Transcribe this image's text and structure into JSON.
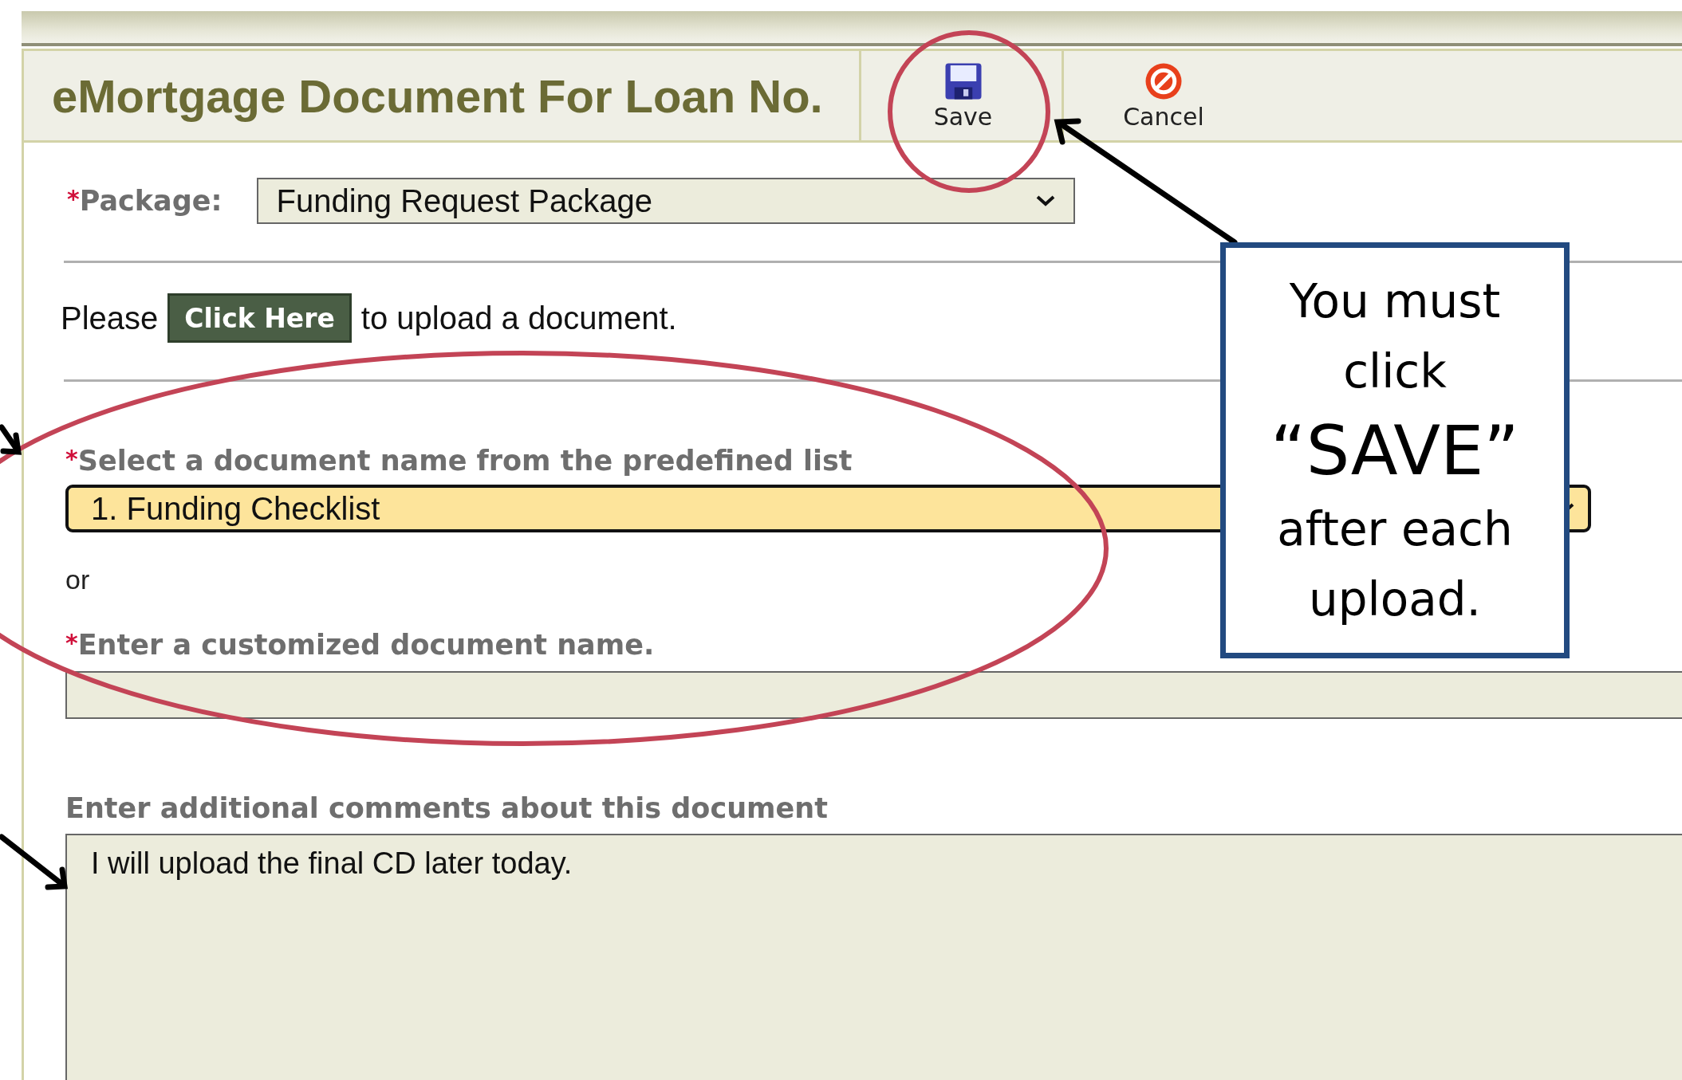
{
  "header": {
    "title": "eMortgage Document For Loan No.",
    "actions": [
      {
        "kind": "save",
        "label": "Save"
      },
      {
        "kind": "cancel",
        "label": "Cancel"
      }
    ]
  },
  "package": {
    "marker": "*",
    "label": "Package:",
    "value": "Funding Request Package"
  },
  "upload": {
    "before": "Please",
    "button": "Click Here",
    "after": "to upload a document."
  },
  "document_select": {
    "marker": "*",
    "label": "Select a document name from the predefined list",
    "value": "1. Funding Checklist"
  },
  "separator_text": "or",
  "custom_name": {
    "marker": "*",
    "label": "Enter a customized document name."
  },
  "comments": {
    "label": "Enter additional comments about this document",
    "value": "I will upload the final CD later today."
  },
  "callout": {
    "lines": [
      {
        "text": "You must",
        "emphasis": false
      },
      {
        "text": "click",
        "emphasis": false
      },
      {
        "text": "“SAVE”",
        "emphasis": true
      },
      {
        "text": "after each",
        "emphasis": false
      },
      {
        "text": "upload.",
        "emphasis": false
      }
    ]
  }
}
